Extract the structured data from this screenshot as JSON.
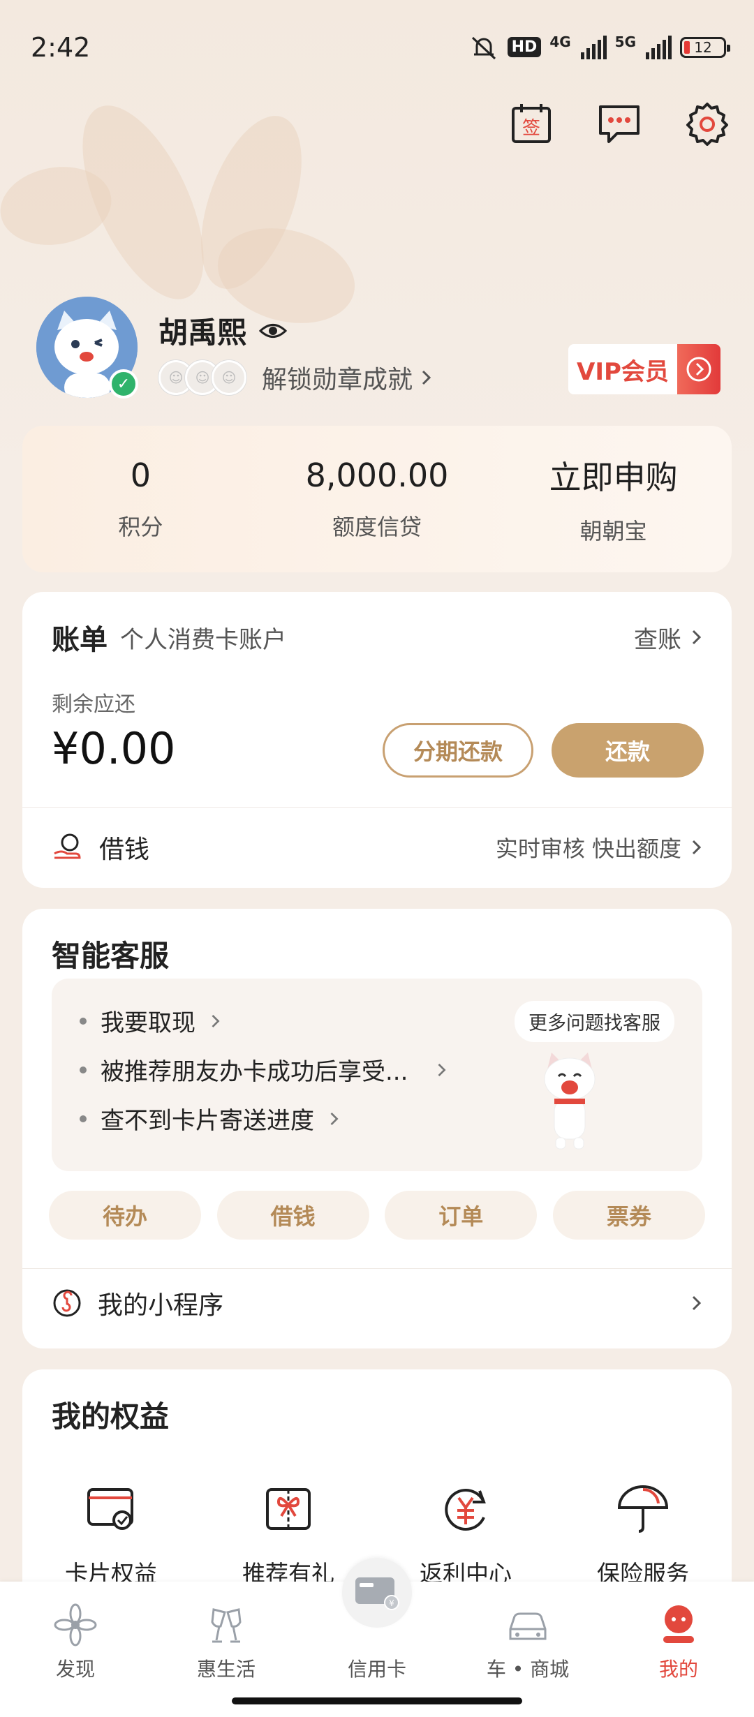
{
  "status": {
    "time": "2:42",
    "hd": "HD",
    "net1": "4G",
    "net2": "5G",
    "battery": "12"
  },
  "header": {
    "sign_icon_text": "签"
  },
  "profile": {
    "name": "胡禹熙",
    "badges_text": "解锁勋章成就",
    "vip_label": "VIP会员"
  },
  "stats": [
    {
      "value": "0",
      "label": "积分"
    },
    {
      "value": "8,000.00",
      "label": "额度信贷"
    },
    {
      "value": "立即申购",
      "label": "朝朝宝"
    }
  ],
  "bill": {
    "title": "账单",
    "subtitle": "个人消费卡账户",
    "link": "查账",
    "remain_label": "剩余应还",
    "remain_value": "¥0.00",
    "installment_btn": "分期还款",
    "repay_btn": "还款",
    "loan_label": "借钱",
    "loan_note": "实时审核 快出额度"
  },
  "service": {
    "title": "智能客服",
    "faqs": [
      "我要取现",
      "被推荐朋友办卡成功后享受...",
      "查不到卡片寄送进度"
    ],
    "more": "更多问题找客服",
    "quick": [
      "待办",
      "借钱",
      "订单",
      "票券"
    ],
    "mini_program": "我的小程序"
  },
  "rights": {
    "title": "我的权益",
    "items": [
      {
        "label": "卡片权益",
        "icon": "card-check-icon"
      },
      {
        "label": "推荐有礼",
        "icon": "gift-icon"
      },
      {
        "label": "返利中心",
        "icon": "yuan-refresh-icon"
      },
      {
        "label": "保险服务",
        "icon": "umbrella-icon"
      }
    ]
  },
  "tabs": [
    {
      "label": "发现",
      "icon": "flower-icon"
    },
    {
      "label": "惠生活",
      "icon": "cheers-icon"
    },
    {
      "label": "信用卡",
      "icon": "credit-card-icon"
    },
    {
      "label": "车 • 商城",
      "icon": "car-icon"
    },
    {
      "label": "我的",
      "icon": "user-icon"
    }
  ],
  "colors": {
    "accent": "#e2483d",
    "gold": "#c9a26e",
    "background": "#f5ede6"
  }
}
